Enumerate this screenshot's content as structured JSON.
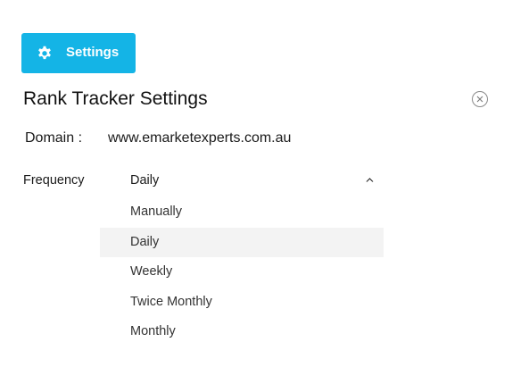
{
  "header": {
    "settings_button_label": "Settings",
    "settings_button_icon": "gear-icon",
    "accent_color": "#14b4e6"
  },
  "dialog": {
    "title": "Rank Tracker Settings",
    "close_icon": "close-icon"
  },
  "domain": {
    "label": "Domain :",
    "value": "www.emarketexperts.com.au"
  },
  "frequency": {
    "label": "Frequency",
    "selected": "Daily",
    "dropdown_open": true,
    "options": [
      "Manually",
      "Daily",
      "Weekly",
      "Twice Monthly",
      "Monthly"
    ],
    "highlighted_option": "Daily"
  }
}
